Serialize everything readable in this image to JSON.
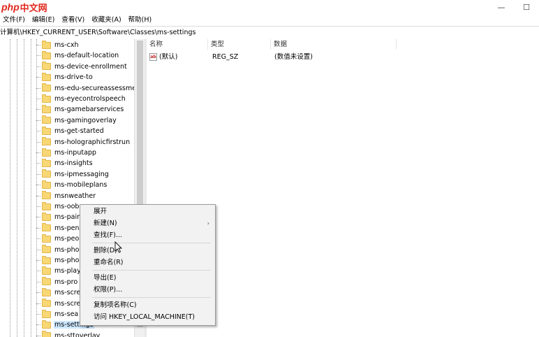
{
  "titlebar": {
    "logo_part1": "php",
    "logo_part2": "中文网",
    "minimize_glyph": "—",
    "maximize_glyph": "☐"
  },
  "menubar": {
    "items": [
      "文件(F)",
      "编辑(E)",
      "查看(V)",
      "收藏夹(A)",
      "帮助(H)"
    ]
  },
  "address": "计算机\\HKEY_CURRENT_USER\\Software\\Classes\\ms-settings",
  "tree": {
    "items": [
      "ms-cxh",
      "ms-default-location",
      "ms-device-enrollment",
      "ms-drive-to",
      "ms-edu-secureassessment",
      "ms-eyecontrolspeech",
      "ms-gamebarservices",
      "ms-gamingoverlay",
      "ms-get-started",
      "ms-holographicfirstrun",
      "ms-inputapp",
      "ms-insights",
      "ms-ipmessaging",
      "ms-mobileplans",
      "msnweather",
      "ms-oob",
      "ms-pair",
      "ms-pen",
      "ms-peo",
      "ms-pho",
      "ms-pho",
      "ms-play",
      "ms-pro",
      "ms-scre",
      "ms-scre",
      "ms-sea",
      "ms-settings",
      "ms-sttoverlay"
    ],
    "selected_index": 26
  },
  "list": {
    "headers": [
      "名称",
      "类型",
      "数据"
    ],
    "rows": [
      {
        "icon": "ab-string-icon",
        "icon_text": "ab",
        "name": "(默认)",
        "type": "REG_SZ",
        "data": "(数值未设置)"
      }
    ]
  },
  "context_menu": {
    "items": [
      {
        "label": "展开",
        "submenu": false
      },
      {
        "label": "新建(N)",
        "submenu": true
      },
      {
        "label": "查找(F)...",
        "submenu": false
      },
      {
        "label": "删除(D)",
        "submenu": false
      },
      {
        "label": "重命名(R)",
        "submenu": false
      },
      {
        "label": "导出(E)",
        "submenu": false
      },
      {
        "label": "权限(P)...",
        "submenu": false
      },
      {
        "label": "复制项名称(C)",
        "submenu": false
      },
      {
        "label": "访问 HKEY_LOCAL_MACHINE(T)",
        "submenu": false
      }
    ],
    "submenu_glyph": "›"
  },
  "colors": {
    "selection": "#cce8ff",
    "folder": "#f8d775",
    "logo_red": "#e0271c"
  }
}
